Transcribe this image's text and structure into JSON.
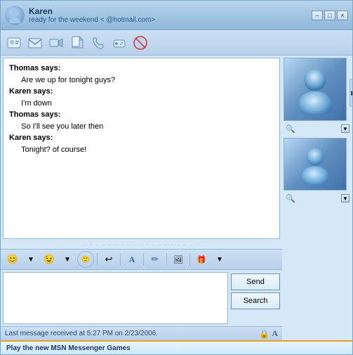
{
  "window": {
    "title": "Karen",
    "status": "ready for the weekend <",
    "email": "@hotmail.com>"
  },
  "titlebar": {
    "minimize": "−",
    "maximize": "□",
    "close": "×"
  },
  "toolbar": {
    "icons": [
      {
        "name": "contact-icon",
        "label": "View Contact"
      },
      {
        "name": "email-icon",
        "label": "Send Email"
      },
      {
        "name": "video-icon",
        "label": "Video"
      },
      {
        "name": "file-icon",
        "label": "Send File"
      },
      {
        "name": "phone-icon",
        "label": "Phone"
      },
      {
        "name": "games-icon",
        "label": "Games"
      },
      {
        "name": "block-icon",
        "label": "Block"
      }
    ]
  },
  "messages": [
    {
      "speaker": "Thomas says:",
      "text": null
    },
    {
      "speaker": null,
      "text": "Are we up for tonight guys?"
    },
    {
      "speaker": "Karen says:",
      "text": null
    },
    {
      "speaker": null,
      "text": "I'm down"
    },
    {
      "speaker": "Thomas says:",
      "text": null
    },
    {
      "speaker": null,
      "text": "So I'll see you later then"
    },
    {
      "speaker": "Karen says:",
      "text": null
    },
    {
      "speaker": null,
      "text": "Tonight? of course!"
    }
  ],
  "input_toolbar": {
    "icons": [
      {
        "name": "emoticon-icon",
        "label": "Emoticons",
        "symbol": "🙂"
      },
      {
        "name": "wink-icon",
        "label": "Winks",
        "symbol": "😉"
      },
      {
        "name": "nudge-icon",
        "label": "Nudge",
        "symbol": "😊"
      },
      {
        "name": "back-icon",
        "label": "Back",
        "symbol": "↩"
      },
      {
        "name": "font-icon",
        "label": "Font",
        "symbol": "Aa"
      },
      {
        "name": "ink-icon",
        "label": "Ink",
        "symbol": "✏"
      },
      {
        "name": "photo-icon",
        "label": "Photo",
        "symbol": "🖼"
      },
      {
        "name": "gift-icon",
        "label": "Gift",
        "symbol": "🎁"
      }
    ]
  },
  "buttons": {
    "send": "Send",
    "search": "Search"
  },
  "status_bar": {
    "text": "Last message received at 5:27 PM on 2/23/2006."
  },
  "footer": {
    "text": "Play the new MSN Messenger Games"
  },
  "right_panel": {
    "arrow": "▶",
    "dropdown": "▼",
    "magnify": "🔍"
  }
}
